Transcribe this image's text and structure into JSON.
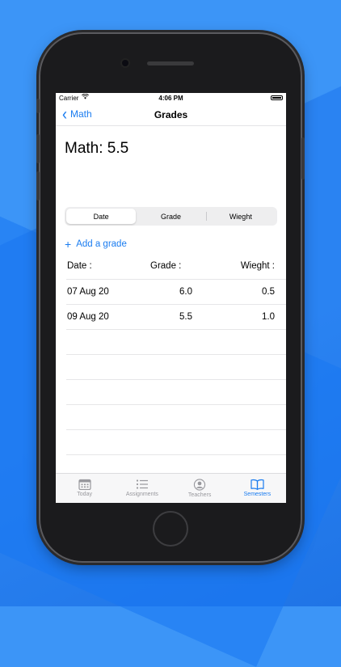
{
  "status_bar": {
    "carrier": "Carrier",
    "time": "4:06 PM"
  },
  "nav": {
    "back_label": "Math",
    "title": "Grades"
  },
  "heading": "Math: 5.5",
  "segments": [
    {
      "label": "Date",
      "selected": true
    },
    {
      "label": "Grade",
      "selected": false
    },
    {
      "label": "Wieght",
      "selected": false
    }
  ],
  "add_grade_label": "Add a grade",
  "table": {
    "headers": [
      "Date :",
      "Grade :",
      "Wieght :"
    ],
    "rows": [
      {
        "date": "07 Aug 20",
        "grade": "6.0",
        "weight": "0.5"
      },
      {
        "date": "09 Aug 20",
        "grade": "5.5",
        "weight": "1.0"
      }
    ]
  },
  "tabbar": [
    {
      "label": "Today",
      "icon": "calendar-icon",
      "selected": false
    },
    {
      "label": "Assignments",
      "icon": "list-icon",
      "selected": false
    },
    {
      "label": "Teachers",
      "icon": "person-icon",
      "selected": false
    },
    {
      "label": "Semesters",
      "icon": "book-icon",
      "selected": true
    }
  ],
  "colors": {
    "accent": "#1a7cf0",
    "background": "#2a83f2",
    "phone": "#1b1b1d"
  }
}
